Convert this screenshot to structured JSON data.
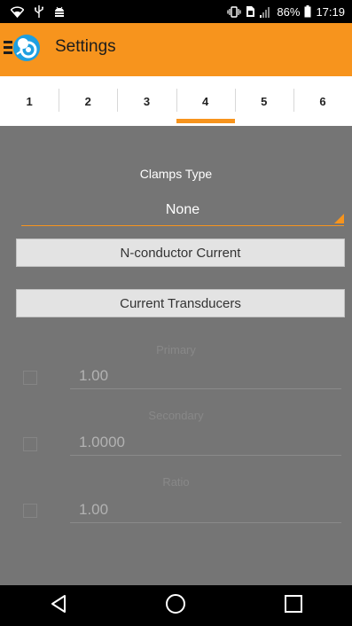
{
  "status_bar": {
    "battery": "86%",
    "time": "17:19"
  },
  "app_bar": {
    "title": "Settings"
  },
  "tabs": [
    {
      "label": "1",
      "active": false
    },
    {
      "label": "2",
      "active": false
    },
    {
      "label": "3",
      "active": false
    },
    {
      "label": "4",
      "active": true
    },
    {
      "label": "5",
      "active": false
    },
    {
      "label": "6",
      "active": false
    }
  ],
  "clamps": {
    "label": "Clamps Type",
    "value": "None"
  },
  "buttons": {
    "n_conductor": "N-conductor Current",
    "current_transducers": "Current Transducers"
  },
  "fields": {
    "primary": {
      "label": "Primary",
      "value": "1.00"
    },
    "secondary": {
      "label": "Secondary",
      "value": "1.0000"
    },
    "ratio": {
      "label": "Ratio",
      "value": "1.00"
    }
  },
  "colors": {
    "accent": "#f7941d",
    "content_bg": "#757575"
  }
}
